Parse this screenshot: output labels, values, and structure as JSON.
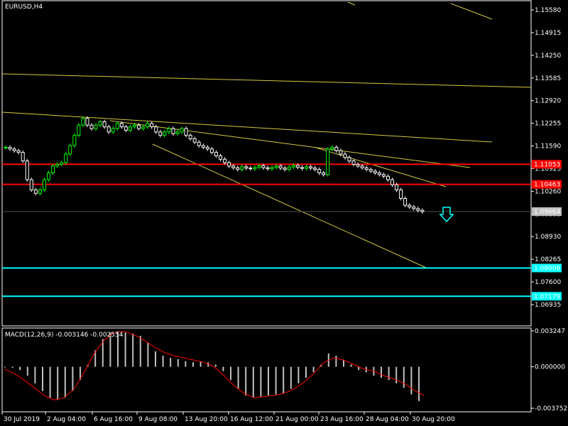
{
  "window": {
    "title": "EURUSD,H4"
  },
  "colors": {
    "background": "#000000",
    "foreground": "#ffffff",
    "candle_up": "#00ff00",
    "candle_down": "#ffffff",
    "trendline": "#d4c840",
    "support_resistance": "#ff0000",
    "target_level": "#00ffff",
    "macd_histogram": "#c0c0c0",
    "macd_signal": "#ff0000"
  },
  "icons": {
    "signal_arrow": "down-arrow-icon"
  },
  "chart_data": [
    {
      "type": "candlestick",
      "symbol": "EURUSD",
      "timeframe": "H4",
      "title": "EURUSD,H4",
      "ylim": [
        1.0665,
        1.1585
      ],
      "yticks": [
        "1.15580",
        "1.14915",
        "1.14250",
        "1.13585",
        "1.12920",
        "1.12255",
        "1.11590",
        "1.10925",
        "1.10260",
        "1.09595",
        "1.08930",
        "1.08265",
        "1.07600",
        "1.06935"
      ],
      "xticks": [
        "30 Jul 2019",
        "2 Aug 04:00",
        "6 Aug 16:00",
        "9 Aug 08:00",
        "13 Aug 20:00",
        "16 Aug 12:00",
        "21 Aug 00:00",
        "23 Aug 16:00",
        "28 Aug 04:00",
        "30 Aug 20:00"
      ],
      "close_series": [
        1.1155,
        1.115,
        1.1145,
        1.114,
        1.1115,
        1.106,
        1.103,
        1.102,
        1.103,
        1.106,
        1.108,
        1.11,
        1.1105,
        1.111,
        1.1135,
        1.116,
        1.119,
        1.122,
        1.124,
        1.122,
        1.121,
        1.122,
        1.123,
        1.1215,
        1.12,
        1.121,
        1.1225,
        1.1215,
        1.1205,
        1.1215,
        1.122,
        1.121,
        1.1215,
        1.1225,
        1.1215,
        1.12,
        1.119,
        1.12,
        1.121,
        1.1195,
        1.12,
        1.121,
        1.119,
        1.118,
        1.117,
        1.116,
        1.1155,
        1.115,
        1.114,
        1.113,
        1.112,
        1.111,
        1.11,
        1.1095,
        1.109,
        1.1098,
        1.1094,
        1.1092,
        1.1096,
        1.1101,
        1.1095,
        1.1092,
        1.1096,
        1.11,
        1.1094,
        1.109,
        1.1097,
        1.1102,
        1.1096,
        1.1093,
        1.1098,
        1.1094,
        1.109,
        1.108,
        1.1075,
        1.115,
        1.1155,
        1.1145,
        1.1135,
        1.1125,
        1.1115,
        1.1105,
        1.11,
        1.1095,
        1.109,
        1.1085,
        1.108,
        1.1075,
        1.107,
        1.106,
        1.1045,
        1.103,
        1.1005,
        1.0985,
        1.098,
        1.0975,
        1.097,
        1.0966
      ],
      "horizontal_levels": [
        {
          "value": 1.11053,
          "label": "1.11053",
          "color": "#ff0000"
        },
        {
          "value": 1.10463,
          "label": "1.10463",
          "color": "#ff0000"
        },
        {
          "value": 1.09664,
          "label": "1.09664",
          "color": "#000000",
          "label_bg": "#c0c0c0"
        },
        {
          "value": 1.08008,
          "label": "1.08008",
          "color": "#00ffff"
        },
        {
          "value": 1.07179,
          "label": "1.07179",
          "color": "#00ffff"
        }
      ],
      "signal": "down arrow"
    },
    {
      "type": "histogram+line",
      "title": "MACD(12,26,9) -0.003146 -0.002554",
      "indicator": "MACD(12,26,9)",
      "macd_value": -0.003146,
      "signal_value": -0.002554,
      "ylim": [
        -0.003752,
        0.003247
      ],
      "yticks": [
        "0.003247",
        "0.000000",
        "-0.003752"
      ],
      "histogram": [
        0.0,
        -0.0001,
        -0.0003,
        -0.0008,
        -0.0015,
        -0.0022,
        -0.0028,
        -0.003,
        -0.0028,
        -0.0022,
        -0.0012,
        0.0002,
        0.0015,
        0.0025,
        0.0031,
        0.0032,
        0.0031,
        0.003,
        0.0028,
        0.0022,
        0.0014,
        0.001,
        0.0008,
        0.0007,
        0.0005,
        0.0004,
        0.0005,
        0.0004,
        0.0002,
        -0.0004,
        -0.0012,
        -0.002,
        -0.0026,
        -0.0028,
        -0.0027,
        -0.0026,
        -0.0025,
        -0.0024,
        -0.002,
        -0.0015,
        -0.001,
        -0.0005,
        0.0002,
        0.0012,
        0.001,
        0.0006,
        0.0002,
        -0.0003,
        -0.0005,
        -0.0008,
        -0.001,
        -0.0012,
        -0.0015,
        -0.0019,
        -0.0025,
        -0.0031
      ],
      "signal_line": [
        -0.0002,
        -0.0006,
        -0.0012,
        -0.0019,
        -0.0026,
        -0.003,
        -0.0028,
        -0.002,
        -0.0005,
        0.0012,
        0.0024,
        0.0031,
        0.0032,
        0.0029,
        0.0024,
        0.0018,
        0.0013,
        0.001,
        0.0008,
        0.0006,
        0.0004,
        0.0,
        -0.0008,
        -0.0017,
        -0.0024,
        -0.0028,
        -0.0027,
        -0.0026,
        -0.0024,
        -0.002,
        -0.0014,
        -0.0006,
        0.0004,
        0.0008,
        0.0006,
        0.0002,
        -0.0002,
        -0.0004,
        -0.0008,
        -0.0011,
        -0.0015,
        -0.0021,
        -0.0026
      ]
    }
  ]
}
